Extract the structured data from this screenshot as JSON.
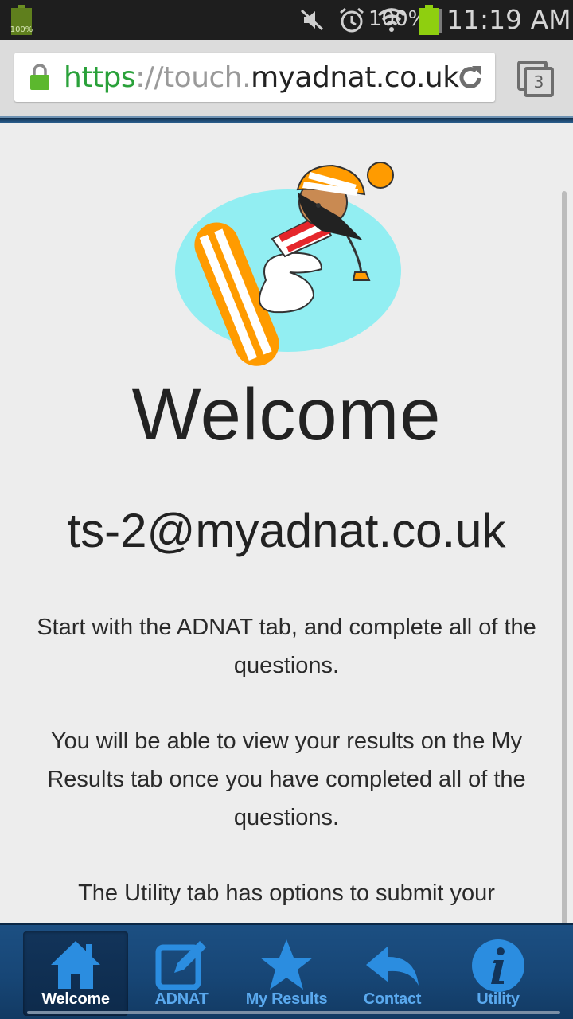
{
  "status_bar": {
    "left_battery_pct": "100%",
    "battery_pct": "100%",
    "time": "11:19 AM",
    "icons": [
      "mute-icon",
      "alarm-icon",
      "wifi-icon",
      "signal-icon"
    ]
  },
  "browser": {
    "url_scheme": "https",
    "url_separator": "://",
    "url_subdomain": "touch.",
    "url_domain": "myadnat.co.uk",
    "tab_count": "3"
  },
  "page": {
    "title": "Welcome",
    "email": "ts-2@myadnat.co.uk",
    "paragraphs": [
      "Start with the ADNAT tab, and complete all of the questions.",
      "You will be able to view your results on the My Results tab once you have completed all of the questions.",
      "The Utility tab has options to submit your"
    ]
  },
  "tabbar": {
    "tabs": [
      {
        "label": "Welcome",
        "icon": "home-icon",
        "active": true
      },
      {
        "label": "ADNAT",
        "icon": "edit-icon",
        "active": false
      },
      {
        "label": "My Results",
        "icon": "star-icon",
        "active": false
      },
      {
        "label": "Contact",
        "icon": "reply-icon",
        "active": false
      },
      {
        "label": "Utility",
        "icon": "info-icon",
        "active": false
      }
    ]
  },
  "colors": {
    "accent": "#2b8de0",
    "tabbar_bg": "#174676",
    "url_secure_green": "#2aa13a",
    "hero_circle": "#92eef2",
    "hero_orange": "#ff9b00"
  }
}
